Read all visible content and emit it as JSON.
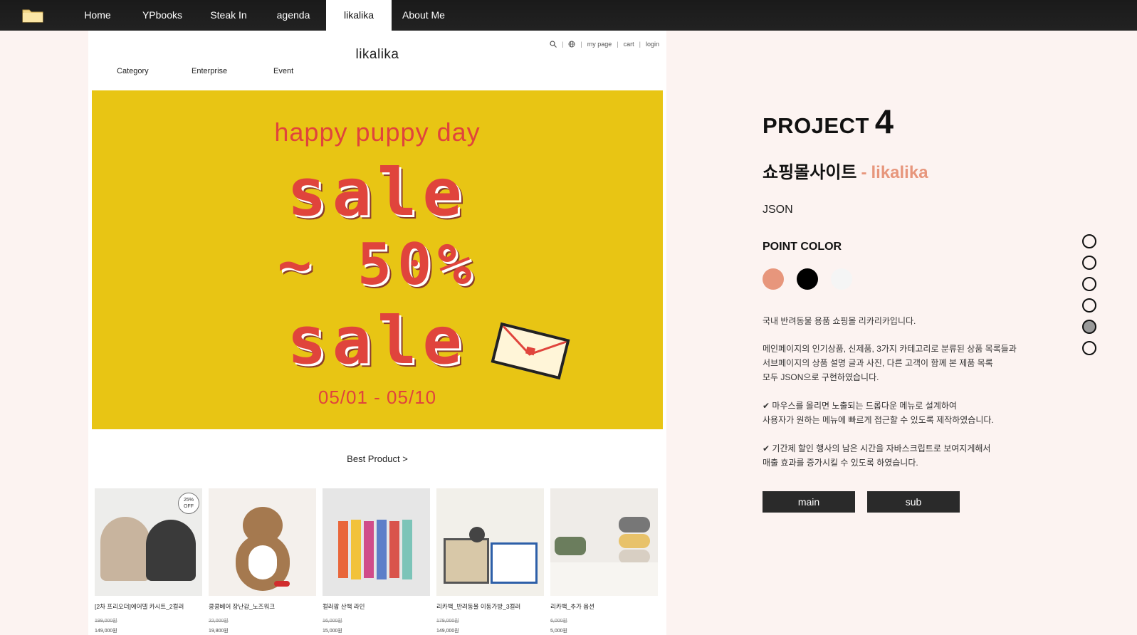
{
  "nav": {
    "items": [
      {
        "label": "Home"
      },
      {
        "label": "YPbooks"
      },
      {
        "label": "Steak In"
      },
      {
        "label": "agenda"
      },
      {
        "label": "likalika",
        "active": true
      },
      {
        "label": "About Me"
      }
    ]
  },
  "preview": {
    "util": {
      "search_icon": "search-icon",
      "globe_icon": "globe-icon",
      "sep": "|",
      "mypage": "my page",
      "cart": "cart",
      "login": "login"
    },
    "logo": "likalika",
    "menu": [
      "Category",
      "Enterprise",
      "Event"
    ],
    "banner": {
      "headline": "happy puppy day",
      "line1": "sale",
      "line2": "~ 50%",
      "line3": "sale",
      "dates": "05/01 - 05/10",
      "badge": {
        "top": "25%",
        "bottom": "OFF"
      }
    },
    "best_link": "Best Product >",
    "products": [
      {
        "name": "[2차 프리오더]에어델 카시트_2컬러",
        "old": "199,000원",
        "price": "149,000원",
        "colors": [
          "#c8b49e",
          "#3a3a3a"
        ]
      },
      {
        "name": "쿵쿵베어 장난감_노즈워크",
        "old": "22,000원",
        "price": "19,800원",
        "colors": [
          "#a5794f",
          "#f4f0ec"
        ]
      },
      {
        "name": "컬러팝 산책 라인",
        "old": "16,000원",
        "price": "15,000원",
        "colors": [
          "#e9663a",
          "#5d7fc9"
        ]
      },
      {
        "name": "리카백_반려동물 이동가방_3컬러",
        "old": "179,000원",
        "price": "149,000원",
        "colors": [
          "#d8c8a8",
          "#2d5fa8"
        ]
      },
      {
        "name": "리카백_추가 옵션",
        "old": "6,000원",
        "price": "5,000원",
        "colors": [
          "#6b7d5d",
          "#e8c26a"
        ]
      }
    ]
  },
  "project": {
    "word": "PROJECT",
    "number": "4",
    "subtitle_kr": "쇼핑몰사이트",
    "dash": "-",
    "brand": "likalika",
    "tech": "JSON",
    "point_color_label": "POINT COLOR",
    "point_colors": [
      "#e7967c",
      "#000000",
      "#f5f5f5"
    ],
    "desc1": "국내 반려동물 용품 쇼핑몰 리카리카입니다.",
    "desc2": [
      "메인페이지의 인기상품, 신제품, 3가지 카테고리로 분류된 상품 목록들과",
      "서브페이지의 상품 설명 글과 사진, 다른 고객이 함께 본 제품 목록",
      "모두 JSON으로 구현하였습니다."
    ],
    "desc3": [
      "마우스를 올리면 노출되는 드롭다운 메뉴로 설계하여",
      "사용자가 원하는 메뉴에 빠르게 접근할 수 있도록 제작하였습니다."
    ],
    "desc4": [
      "기간제 할인 행사의 남은 시간을 자바스크립트로 보여지게해서",
      "매출 효과를 증가시킬 수 있도록 하였습니다."
    ],
    "btn_main": "main",
    "btn_sub": "sub"
  },
  "pager": {
    "count": 6,
    "active_index": 4
  }
}
